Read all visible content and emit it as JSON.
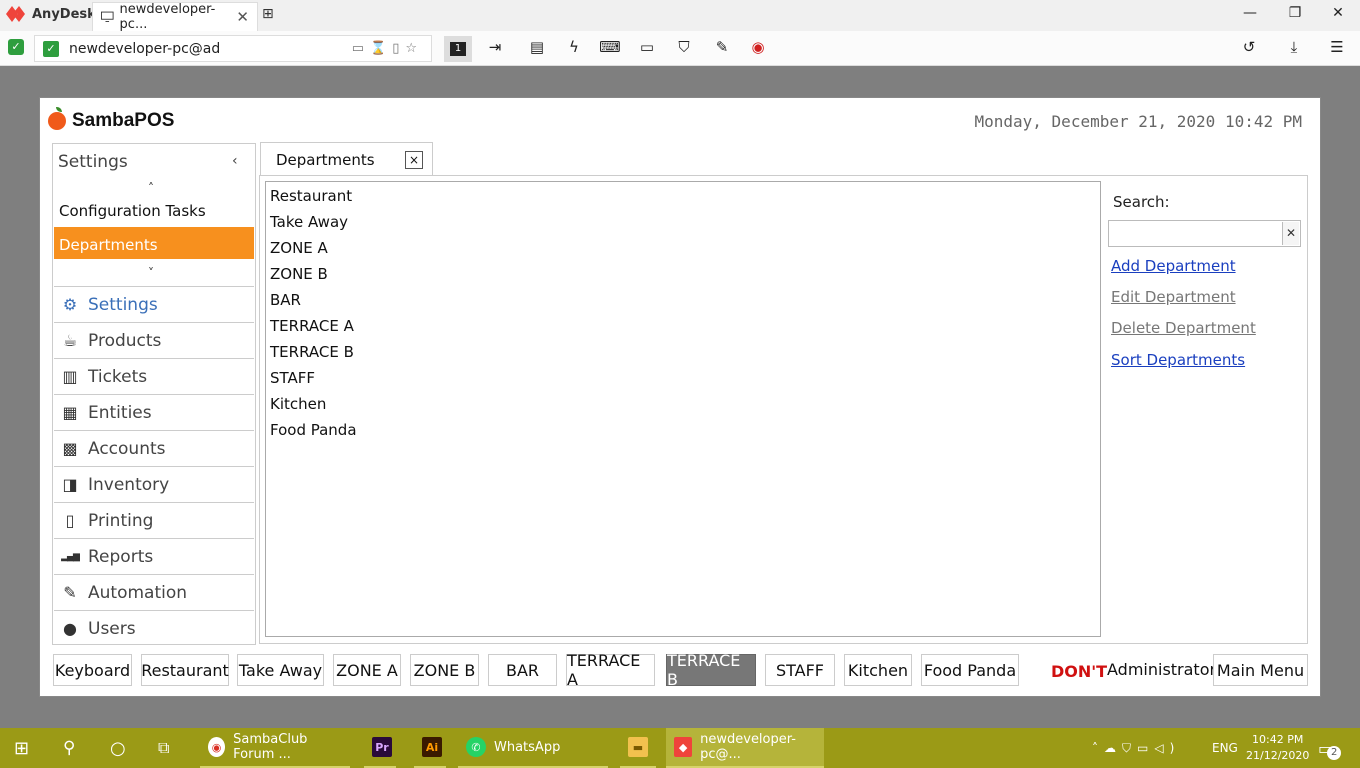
{
  "anydesk": {
    "app_name": "AnyDesk",
    "tab_label": "newdeveloper-pc...",
    "address": "newdeveloper-pc@ad",
    "monitor_badge": "1",
    "accent_color": "#ef443b"
  },
  "app": {
    "brand": "SambaPOS",
    "datetime": "Monday, December 21, 2020 10:42 PM"
  },
  "sidebar": {
    "header": "Settings",
    "config_tasks": "Configuration Tasks",
    "selected": "Departments",
    "items": [
      {
        "label": "Settings",
        "icon": "gear-icon"
      },
      {
        "label": "Products",
        "icon": "coffee-cup-icon"
      },
      {
        "label": "Tickets",
        "icon": "books-icon"
      },
      {
        "label": "Entities",
        "icon": "grid-icon"
      },
      {
        "label": "Accounts",
        "icon": "calculator-icon"
      },
      {
        "label": "Inventory",
        "icon": "inventory-icon"
      },
      {
        "label": "Printing",
        "icon": "document-icon"
      },
      {
        "label": "Reports",
        "icon": "bar-chart-icon"
      },
      {
        "label": "Automation",
        "icon": "pen-icon"
      },
      {
        "label": "Users",
        "icon": "user-icon"
      }
    ]
  },
  "document_tab": {
    "label": "Departments",
    "close": "×"
  },
  "departments": [
    "Restaurant",
    "Take Away",
    "ZONE A",
    "ZONE B",
    "BAR",
    "TERRACE A",
    "TERRACE B",
    "STAFF",
    "Kitchen",
    "Food Panda"
  ],
  "actions": {
    "search_label": "Search:",
    "search_value": "",
    "add": "Add Department",
    "edit": "Edit Department",
    "delete": "Delete Department",
    "sort": "Sort Departments"
  },
  "bottom_bar": {
    "buttons": [
      "Keyboard",
      "Restaurant",
      "Take Away",
      "ZONE A",
      "ZONE B",
      "BAR",
      "TERRACE A",
      "TERRACE B",
      "STAFF",
      "Kitchen",
      "Food Panda"
    ],
    "selected": "TERRACE B",
    "warning": "DON'T",
    "user": "Administrator",
    "main_menu": "Main Menu"
  },
  "taskbar": {
    "apps": [
      {
        "label": "SambaClub Forum ...",
        "icon": "chrome-icon"
      },
      {
        "label": "",
        "icon": "premiere-icon"
      },
      {
        "label": "",
        "icon": "illustrator-icon"
      },
      {
        "label": "WhatsApp",
        "icon": "whatsapp-icon"
      },
      {
        "label": "",
        "icon": "folder-icon"
      },
      {
        "label": "newdeveloper-pc@...",
        "icon": "anydesk-icon"
      }
    ],
    "lang": "ENG",
    "time": "10:42 PM",
    "date": "21/12/2020",
    "notifications": "2",
    "color": "#9b9a16"
  }
}
